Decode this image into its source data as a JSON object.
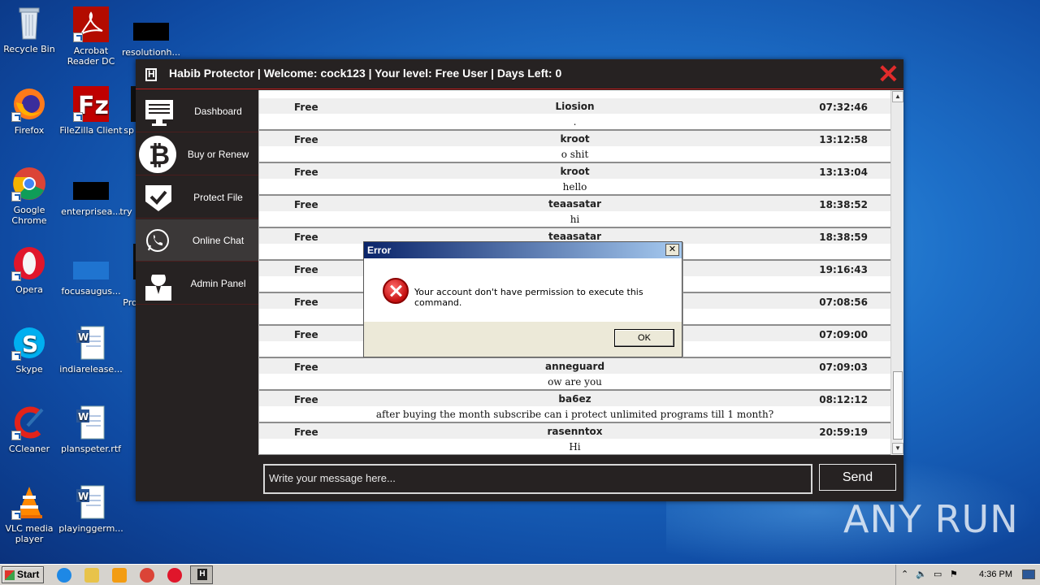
{
  "desktop": {
    "icons": [
      {
        "label": "Recycle Bin"
      },
      {
        "label": "Acrobat Reader DC"
      },
      {
        "label": "resolutionh..."
      },
      {
        "label": "Firefox"
      },
      {
        "label": "FileZilla Client"
      },
      {
        "label": "sp"
      },
      {
        "label": "Google Chrome"
      },
      {
        "label": "enterprisea..."
      },
      {
        "label": "try"
      },
      {
        "label": "Opera"
      },
      {
        "label": "focusaugus..."
      },
      {
        "label": "Pro"
      },
      {
        "label": "Skype"
      },
      {
        "label": "indiarelease..."
      },
      {
        "label": "CCleaner"
      },
      {
        "label": "planspeter.rtf"
      },
      {
        "label": "VLC media player"
      },
      {
        "label": "playinggerm..."
      }
    ],
    "watermark": "ANY RUN"
  },
  "app": {
    "title": "Habib Protector | Welcome: cock123 | Your level: Free User | Days Left: 0",
    "sidebar": [
      {
        "label": "Dashboard",
        "icon": "monitor-icon"
      },
      {
        "label": "Buy or Renew",
        "icon": "bitcoin-icon"
      },
      {
        "label": "Protect File",
        "icon": "shield-check-icon"
      },
      {
        "label": "Online Chat",
        "icon": "whatsapp-icon",
        "active": true
      },
      {
        "label": "Admin Panel",
        "icon": "admin-person-icon"
      }
    ],
    "messages": [
      {
        "tier": "Free",
        "user": "Liosion",
        "time": "07:32:46",
        "text": "."
      },
      {
        "tier": "Free",
        "user": "kroot",
        "time": "13:12:58",
        "text": "o shit"
      },
      {
        "tier": "Free",
        "user": "kroot",
        "time": "13:13:04",
        "text": "hello"
      },
      {
        "tier": "Free",
        "user": "teaasatar",
        "time": "18:38:52",
        "text": "hi"
      },
      {
        "tier": "Free",
        "user": "teaasatar",
        "time": "18:38:59",
        "text": ""
      },
      {
        "tier": "Free",
        "user": "",
        "time": "19:16:43",
        "text": ""
      },
      {
        "tier": "Free",
        "user": "",
        "time": "07:08:56",
        "text": ""
      },
      {
        "tier": "Free",
        "user": "",
        "time": "07:09:00",
        "text": ""
      },
      {
        "tier": "Free",
        "user": "anneguard",
        "time": "07:09:03",
        "text": "ow are you"
      },
      {
        "tier": "Free",
        "user": "ba6ez",
        "time": "08:12:12",
        "text": "after buying the month subscribe can i protect unlimited programs till 1 month?"
      },
      {
        "tier": "Free",
        "user": "rasenntox",
        "time": "20:59:19",
        "text": "Hi"
      }
    ],
    "composer_placeholder": "Write your message here...",
    "send_label": "Send"
  },
  "dialog": {
    "title": "Error",
    "message": "Your account don't have permission to execute this command.",
    "ok_label": "OK",
    "close_glyph": "✕"
  },
  "taskbar": {
    "start_label": "Start",
    "clock": "4:36 PM"
  }
}
